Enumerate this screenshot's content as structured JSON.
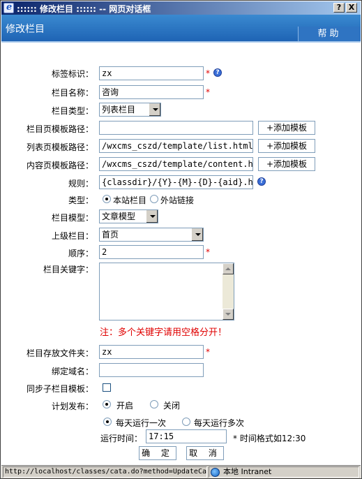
{
  "window": {
    "title": ":::::: 修改栏目 :::::: -- 网页对话框",
    "help_button": "?",
    "close_button": "X"
  },
  "header": {
    "title": "修改栏目",
    "help_tab": "帮助"
  },
  "form": {
    "tag": {
      "label": "标签标识：",
      "value": "zx",
      "required": "*",
      "help_icon": "question-icon"
    },
    "name": {
      "label": "栏目名称：",
      "value": "咨询",
      "required": "*"
    },
    "type_select": {
      "label": "栏目类型：",
      "value": "列表栏目"
    },
    "page_tpl": {
      "label": "栏目页模板路径：",
      "value": "",
      "button": "+添加模板"
    },
    "list_tpl": {
      "label": "列表页模板路径：",
      "value": "/wxcms_cszd/template/list.html",
      "button": "+添加模板"
    },
    "content_tpl": {
      "label": "内容页模板路径：",
      "value": "/wxcms_cszd/template/content.htm",
      "button": "+添加模板"
    },
    "rule": {
      "label": "规则：",
      "value": "{classdir}/{Y}-{M}-{D}-{aid}.html",
      "help_icon": "question-icon"
    },
    "kind": {
      "label": "类型：",
      "option1": "本站栏目",
      "option2": "外站链接",
      "selected": "本站栏目"
    },
    "model": {
      "label": "栏目模型：",
      "value": "文章模型"
    },
    "parent": {
      "label": "上级栏目：",
      "value": "首页"
    },
    "order": {
      "label": "顺序：",
      "value": "2",
      "required": "*"
    },
    "keywords": {
      "label": "栏目关键字：",
      "value": "",
      "note": "注：多个关键字请用空格分开！"
    },
    "folder": {
      "label": "栏目存放文件夹：",
      "value": "zx",
      "required": "*"
    },
    "domain": {
      "label": "绑定域名：",
      "value": ""
    },
    "sync": {
      "label": "同步子栏目模板：",
      "checked": false
    },
    "schedule": {
      "label": "计划发布：",
      "option1": "开启",
      "option2": "关闭",
      "selected": "开启"
    },
    "frequency": {
      "option1": "每天运行一次",
      "option2": "每天运行多次",
      "selected": "每天运行一次"
    },
    "run_time": {
      "label": "运行时间：",
      "value": "17:15",
      "hint": "* 时间格式如12:30"
    },
    "confirm_button": "确 定",
    "cancel_button": "取 消"
  },
  "statusbar": {
    "url": "http://localhost/classes/cata.do?method=UpdateCata",
    "zone": "本地 Intranet"
  }
}
